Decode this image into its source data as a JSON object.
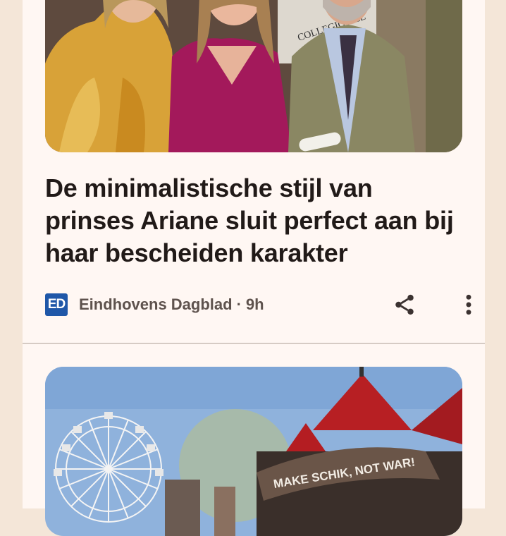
{
  "articles": [
    {
      "headline": "De minimalistische stijl van prinses Ariane sluit perfect aan bij haar bescheiden karakter",
      "source": {
        "logo_text": "ED",
        "name": "Eindhovens Dagblad",
        "separator": "·",
        "age": "9h"
      },
      "image_text": "COLLEGIO DEL",
      "actions": {
        "share_icon": "share-icon",
        "more_icon": "more-vert-icon"
      }
    },
    {
      "image_text": "MAKE SCHIK, NOT WAR!"
    }
  ],
  "colors": {
    "page_background": "#f4e6d8",
    "card_background": "#fff7f3",
    "headline": "#211a18",
    "meta_text": "#5e524d",
    "logo": "#1f57a8",
    "divider": "#d6cbc4"
  }
}
